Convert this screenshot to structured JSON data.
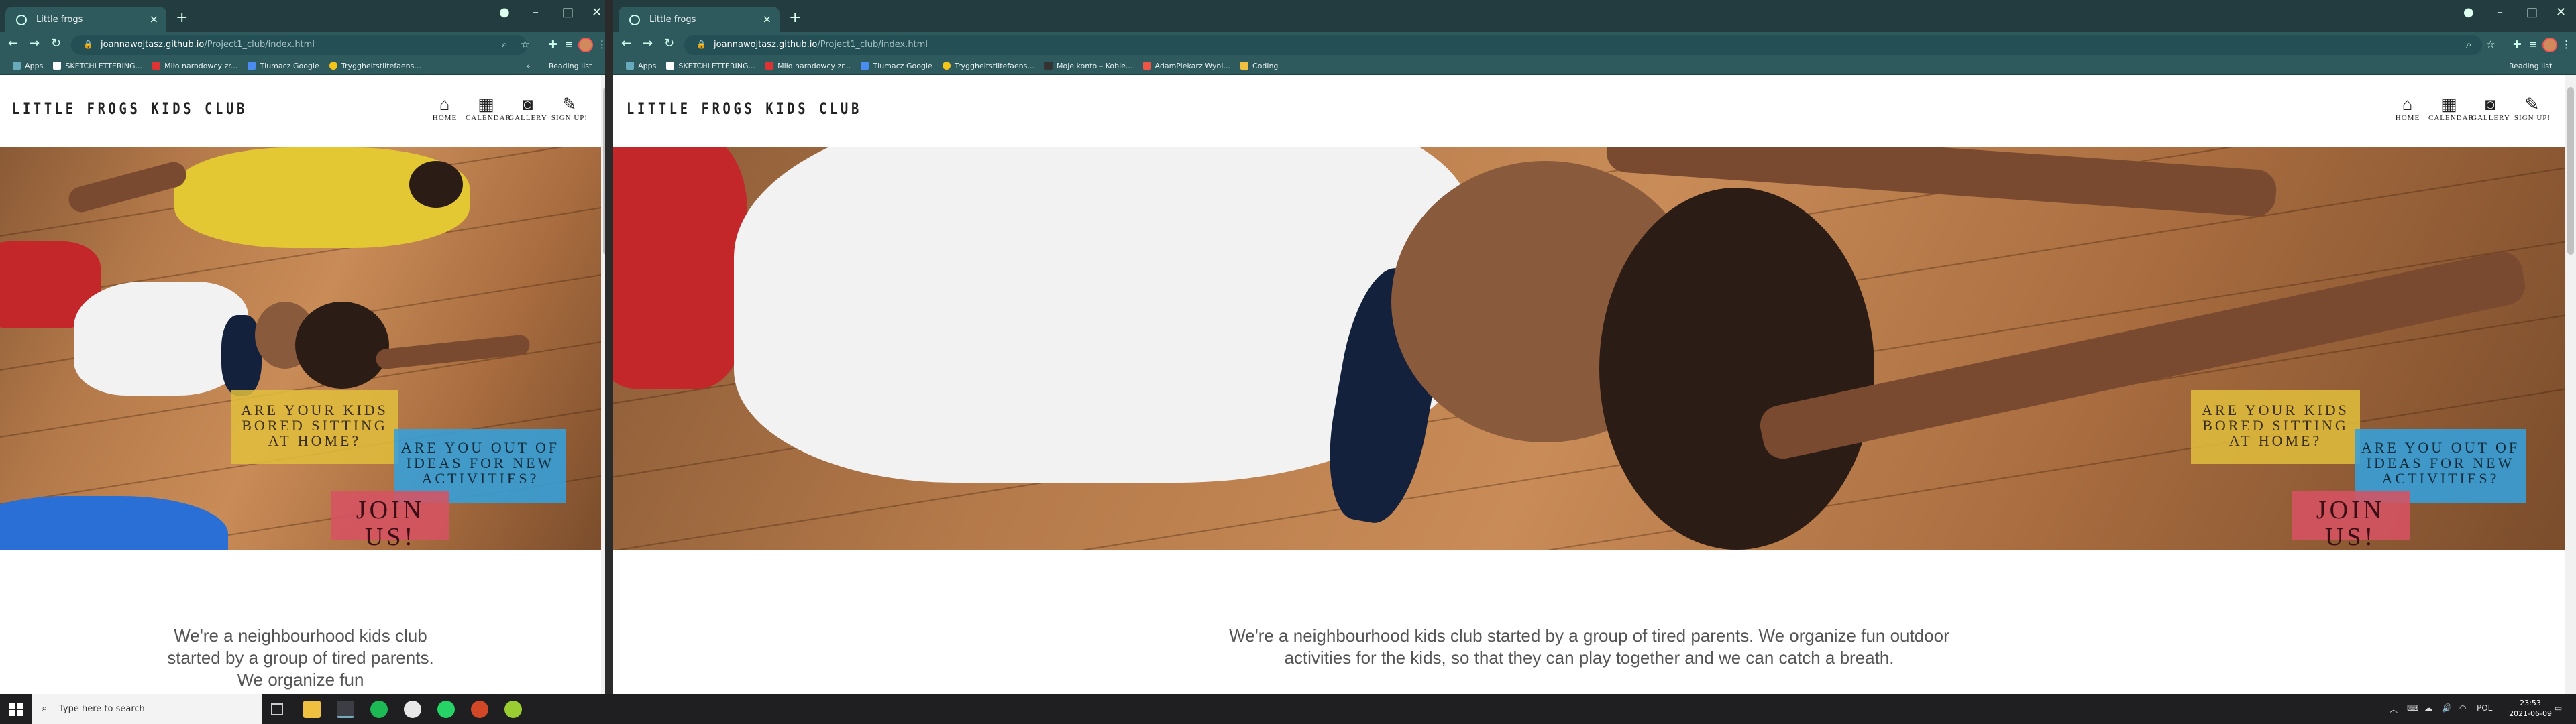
{
  "browser": {
    "tab_title": "Little frogs",
    "url_host": "joannawojtasz.github.io",
    "url_path": "/Project1_club/index.html",
    "bookmarks_left": [
      "Apps",
      "SKETCHLETTERING...",
      "Miło narodowcy zr...",
      "Tłumacz Google",
      "Tryggheitstiltefaens..."
    ],
    "bookmarks_right": [
      "Apps",
      "SKETCHLETTERING...",
      "Miło narodowcy zr...",
      "Tłumacz Google",
      "Tryggheitstiltefaens...",
      "Moje konto – Kobie...",
      "AdamPiekarz Wyni...",
      "Coding"
    ],
    "reading_list": "Reading list",
    "more_bookmarks": "»"
  },
  "site": {
    "logo": "LITTLE FROGS KIDS CLUB",
    "nav": [
      {
        "label": "HOME",
        "icon": "home-icon",
        "glyph": "⌂"
      },
      {
        "label": "CALENDAR",
        "icon": "calendar-icon",
        "glyph": "▦"
      },
      {
        "label": "GALLERY",
        "icon": "camera-icon",
        "glyph": "◙"
      },
      {
        "label": "SIGN UP!",
        "icon": "edit-icon",
        "glyph": "✎"
      }
    ],
    "badge_bored": "ARE YOUR KIDS BORED SITTING AT HOME?",
    "badge_ideas": "ARE YOU OUT OF IDEAS FOR NEW ACTIVITIES?",
    "badge_join": "JOIN US!",
    "intro_left": "We're a neighbourhood kids club started by a group of tired parents. We organize fun",
    "intro_right": "We're a neighbourhood kids club started by a group of tired parents. We organize fun outdoor activities for the kids, so that they can play together and we can catch a breath."
  },
  "taskbar": {
    "search_placeholder": "Type here to search",
    "lang": "POL",
    "time": "23:53",
    "date": "2021-06-09"
  },
  "colors": {
    "browser_dark": "#233c3f",
    "browser_tab": "#2e5a5e",
    "badge_yellow": "#e0be3c",
    "badge_blue": "#34a0dc",
    "badge_red": "#d65262"
  }
}
